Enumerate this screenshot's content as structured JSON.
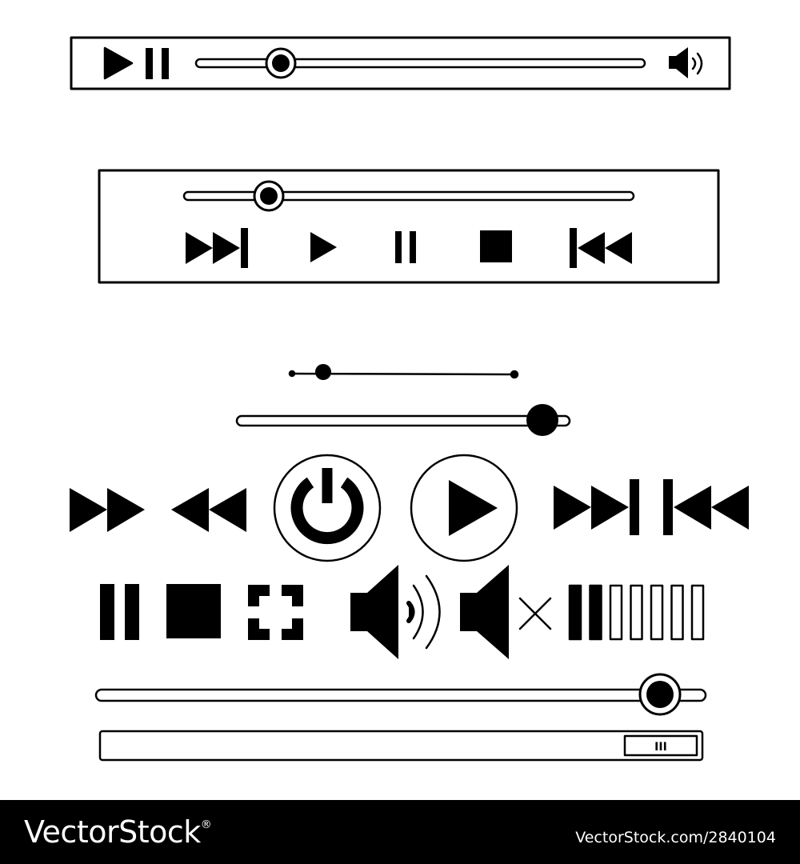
{
  "colors": {
    "ink": "#000000",
    "background": "#ffffff",
    "footer_bg": "#000000",
    "footer_text": "#ffffff"
  },
  "player_bar_top": {
    "controls": [
      "play-icon",
      "pause-icon"
    ],
    "seek_progress": 0.19,
    "volume_icon": "speaker-on-icon"
  },
  "player_bar_middle": {
    "seek_progress": 0.19,
    "controls": [
      "skip-forward-icon",
      "play-icon",
      "pause-icon",
      "stop-icon",
      "skip-back-icon"
    ]
  },
  "sliders": {
    "small_progress": 0.15,
    "medium_progress": 0.92,
    "long_progress": 0.92
  },
  "icon_row_1": [
    "fast-forward-icon",
    "rewind-icon",
    "power-button-icon",
    "play-circle-icon",
    "skip-forward-icon",
    "skip-back-icon"
  ],
  "icon_row_2": [
    "pause-icon",
    "stop-icon",
    "fullscreen-icon",
    "volume-on-icon",
    "mute-icon",
    "volume-level-icon"
  ],
  "volume_level": {
    "filled_bars": 2,
    "total_bars": 7
  },
  "scrollbar": {
    "handle_text": "III"
  },
  "footer": {
    "brand": "VectorStock",
    "brand_mark": "®",
    "stock_id": "VectorStock.com/2840104"
  }
}
